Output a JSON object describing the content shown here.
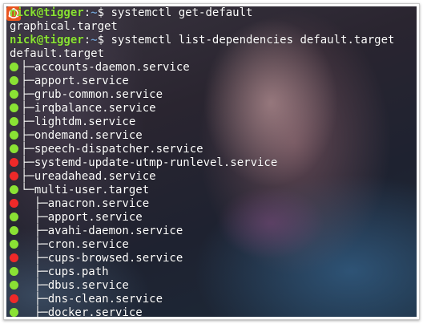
{
  "colors": {
    "prompt_green": "#8ae234",
    "path_blue": "#729fcf",
    "dot_active": "#8ae234",
    "dot_inactive": "#ef2929"
  },
  "terminal": {
    "lines": [
      {
        "type": "prompt",
        "user": "nick@tigger",
        "sep": ":",
        "path": "~",
        "symbol": "$ ",
        "command": "systemctl get-default"
      },
      {
        "type": "output",
        "text": "graphical.target"
      },
      {
        "type": "prompt",
        "user": "nick@tigger",
        "sep": ":",
        "path": "~",
        "symbol": "$ ",
        "command": "systemctl list-dependencies default.target"
      },
      {
        "type": "output",
        "text": "default.target"
      },
      {
        "type": "unit",
        "state": "active",
        "indent": "",
        "branch": "├─",
        "name": "accounts-daemon.service"
      },
      {
        "type": "unit",
        "state": "active",
        "indent": "",
        "branch": "├─",
        "name": "apport.service"
      },
      {
        "type": "unit",
        "state": "active",
        "indent": "",
        "branch": "├─",
        "name": "grub-common.service"
      },
      {
        "type": "unit",
        "state": "active",
        "indent": "",
        "branch": "├─",
        "name": "irqbalance.service"
      },
      {
        "type": "unit",
        "state": "active",
        "indent": "",
        "branch": "├─",
        "name": "lightdm.service"
      },
      {
        "type": "unit",
        "state": "active",
        "indent": "",
        "branch": "├─",
        "name": "ondemand.service"
      },
      {
        "type": "unit",
        "state": "active",
        "indent": "",
        "branch": "├─",
        "name": "speech-dispatcher.service"
      },
      {
        "type": "unit",
        "state": "inactive",
        "indent": "",
        "branch": "├─",
        "name": "systemd-update-utmp-runlevel.service"
      },
      {
        "type": "unit",
        "state": "inactive",
        "indent": "",
        "branch": "├─",
        "name": "ureadahead.service"
      },
      {
        "type": "unit",
        "state": "active",
        "indent": "",
        "branch": "└─",
        "name": "multi-user.target"
      },
      {
        "type": "unit",
        "state": "inactive",
        "indent": "  ",
        "branch": "├─",
        "name": "anacron.service"
      },
      {
        "type": "unit",
        "state": "active",
        "indent": "  ",
        "branch": "├─",
        "name": "apport.service"
      },
      {
        "type": "unit",
        "state": "active",
        "indent": "  ",
        "branch": "├─",
        "name": "avahi-daemon.service"
      },
      {
        "type": "unit",
        "state": "active",
        "indent": "  ",
        "branch": "├─",
        "name": "cron.service"
      },
      {
        "type": "unit",
        "state": "inactive",
        "indent": "  ",
        "branch": "├─",
        "name": "cups-browsed.service"
      },
      {
        "type": "unit",
        "state": "active",
        "indent": "  ",
        "branch": "├─",
        "name": "cups.path"
      },
      {
        "type": "unit",
        "state": "active",
        "indent": "  ",
        "branch": "├─",
        "name": "dbus.service"
      },
      {
        "type": "unit",
        "state": "inactive",
        "indent": "  ",
        "branch": "├─",
        "name": "dns-clean.service"
      },
      {
        "type": "unit",
        "state": "active",
        "indent": "  ",
        "branch": "├─",
        "name": "docker.service"
      }
    ]
  }
}
